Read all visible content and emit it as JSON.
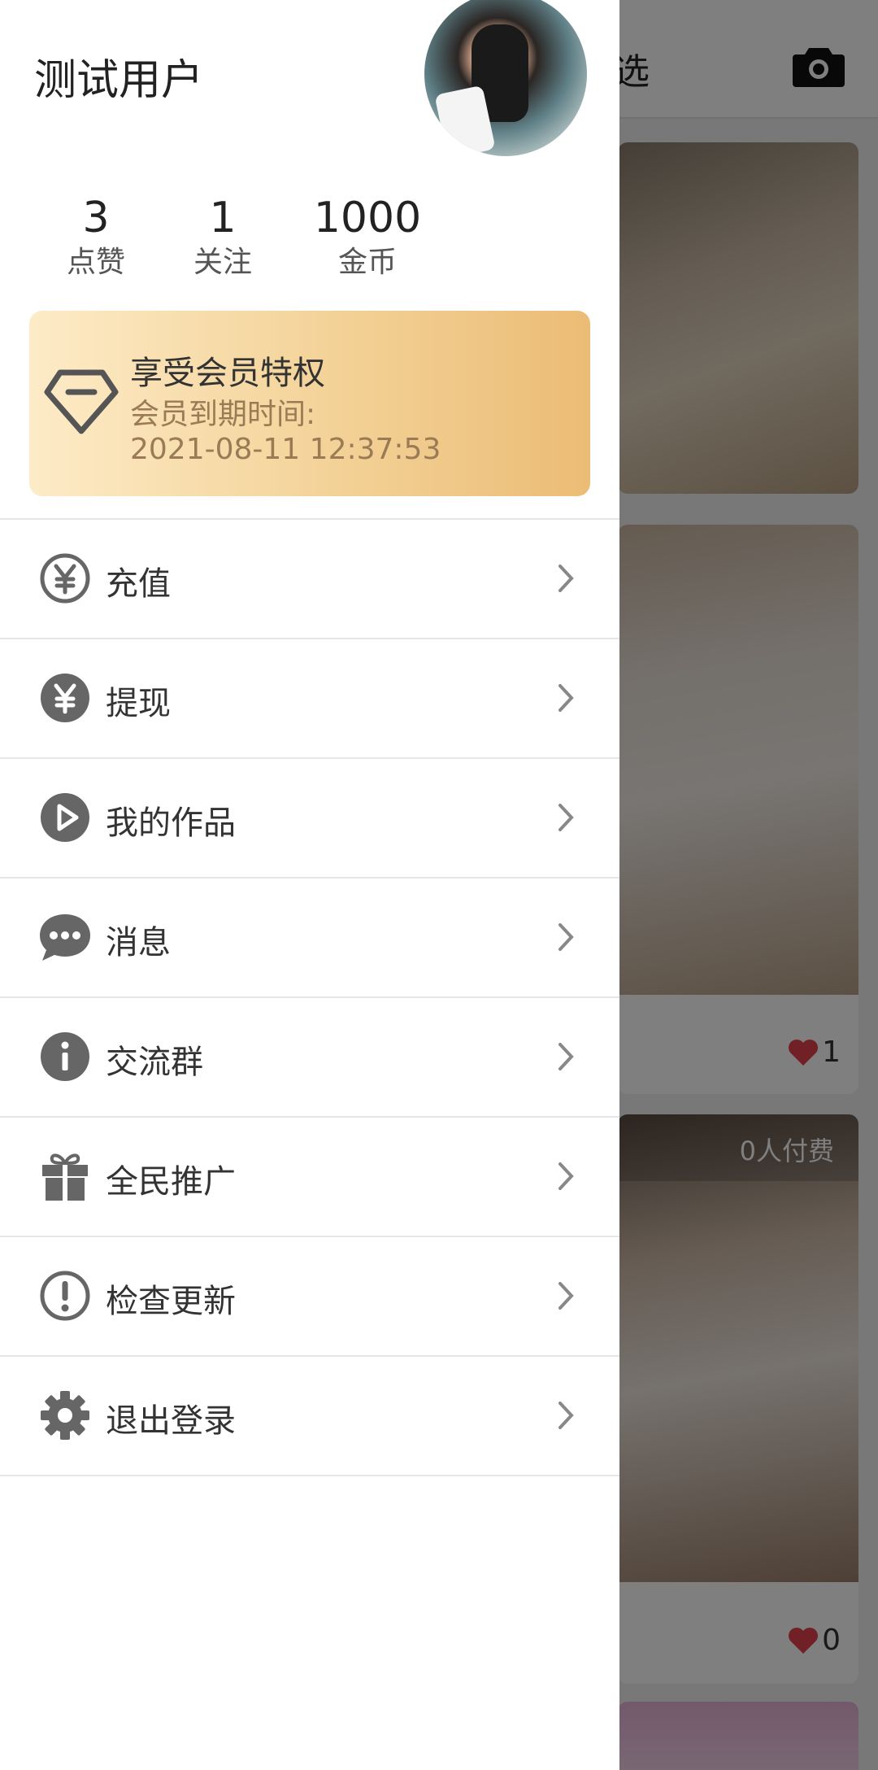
{
  "background": {
    "tab_label": "选",
    "cards": [
      {
        "likes": ""
      },
      {
        "likes": "1"
      },
      {
        "paid_tag": "0人付费",
        "likes": "0"
      }
    ]
  },
  "drawer": {
    "username": "测试用户",
    "stats": [
      {
        "value": "3",
        "label": "点赞"
      },
      {
        "value": "1",
        "label": "关注"
      },
      {
        "value": "1000",
        "label": "金币"
      }
    ],
    "vip": {
      "title": "享受会员特权",
      "expiry_label": "会员到期时间:",
      "expiry_date": "2021-08-11 12:37:53"
    },
    "menu": [
      {
        "label": "充值",
        "icon": "yuan-outline-icon"
      },
      {
        "label": "提现",
        "icon": "yuan-filled-icon"
      },
      {
        "label": "我的作品",
        "icon": "play-circle-icon"
      },
      {
        "label": "消息",
        "icon": "chat-bubble-icon"
      },
      {
        "label": "交流群",
        "icon": "info-circle-icon"
      },
      {
        "label": "全民推广",
        "icon": "gift-icon"
      },
      {
        "label": "检查更新",
        "icon": "exclamation-circle-icon"
      },
      {
        "label": "退出登录",
        "icon": "gear-icon"
      }
    ]
  },
  "colors": {
    "icon_gray": "#666666",
    "heart_red": "#e2424a",
    "vip_gradient_start": "#fdebc7",
    "vip_gradient_end": "#ebbc75"
  }
}
